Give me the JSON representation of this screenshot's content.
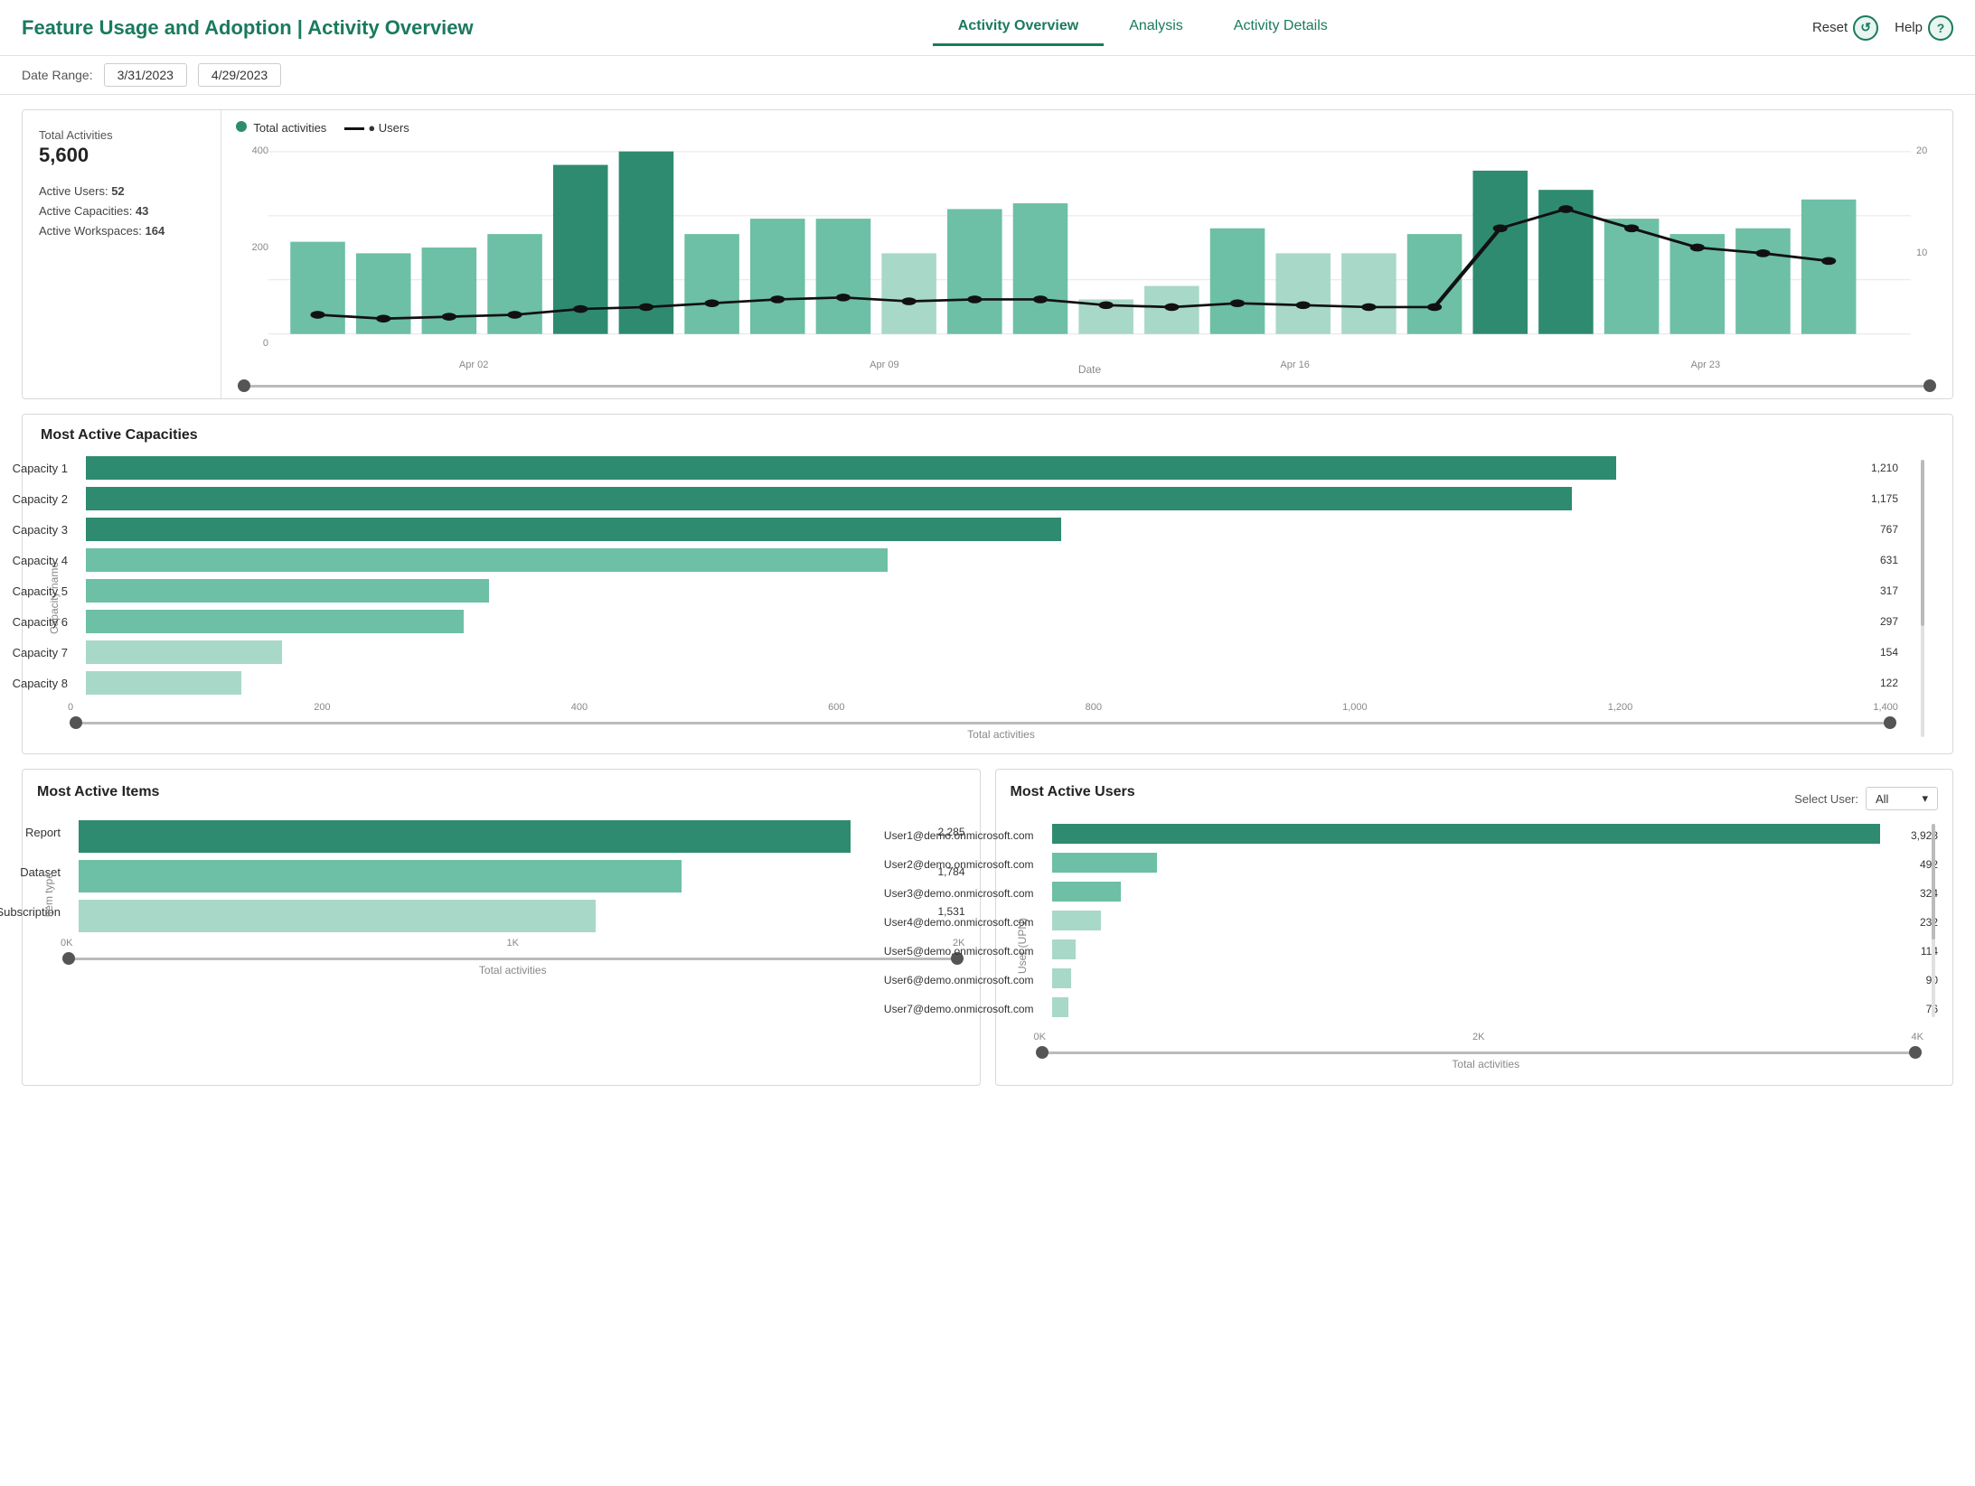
{
  "header": {
    "title": "Feature Usage and Adoption | Activity Overview",
    "nav": [
      {
        "label": "Activity Overview",
        "active": true
      },
      {
        "label": "Analysis",
        "active": false
      },
      {
        "label": "Activity Details",
        "active": false
      }
    ],
    "reset_label": "Reset",
    "help_label": "Help"
  },
  "date_range": {
    "label": "Date Range:",
    "start": "3/31/2023",
    "end": "4/29/2023"
  },
  "summary": {
    "total_activities_label": "Total Activities",
    "total_activities_value": "5,600",
    "active_users_label": "Active Users:",
    "active_users_value": "52",
    "active_capacities_label": "Active Capacities:",
    "active_capacities_value": "43",
    "active_workspaces_label": "Active Workspaces:",
    "active_workspaces_value": "164"
  },
  "activity_chart": {
    "legend_activities": "Total activities",
    "legend_users": "Users",
    "y_left_label": "Total activities",
    "y_right_label": "Users",
    "x_label": "Date",
    "x_ticks": [
      "Apr 02",
      "Apr 09",
      "Apr 16",
      "Apr 23"
    ],
    "y_left_ticks": [
      "0",
      "200",
      "400"
    ],
    "y_right_ticks": [
      "10",
      "20"
    ],
    "bars": [
      {
        "x": 0.03,
        "h": 0.48,
        "shade": 0.7
      },
      {
        "x": 0.07,
        "h": 0.42,
        "shade": 0.7
      },
      {
        "x": 0.11,
        "h": 0.45,
        "shade": 0.7
      },
      {
        "x": 0.15,
        "h": 0.52,
        "shade": 0.7
      },
      {
        "x": 0.19,
        "h": 0.88,
        "shade": 1.0
      },
      {
        "x": 0.23,
        "h": 0.95,
        "shade": 1.0
      },
      {
        "x": 0.27,
        "h": 0.52,
        "shade": 0.7
      },
      {
        "x": 0.31,
        "h": 0.6,
        "shade": 0.7
      },
      {
        "x": 0.35,
        "h": 0.6,
        "shade": 0.7
      },
      {
        "x": 0.39,
        "h": 0.42,
        "shade": 0.5
      },
      {
        "x": 0.43,
        "h": 0.65,
        "shade": 0.7
      },
      {
        "x": 0.47,
        "h": 0.68,
        "shade": 0.7
      },
      {
        "x": 0.51,
        "h": 0.18,
        "shade": 0.3
      },
      {
        "x": 0.55,
        "h": 0.25,
        "shade": 0.3
      },
      {
        "x": 0.59,
        "h": 0.55,
        "shade": 0.7
      },
      {
        "x": 0.63,
        "h": 0.42,
        "shade": 0.5
      },
      {
        "x": 0.67,
        "h": 0.42,
        "shade": 0.5
      },
      {
        "x": 0.71,
        "h": 0.52,
        "shade": 0.7
      },
      {
        "x": 0.75,
        "h": 0.85,
        "shade": 1.0
      },
      {
        "x": 0.79,
        "h": 0.75,
        "shade": 1.0
      },
      {
        "x": 0.83,
        "h": 0.6,
        "shade": 0.7
      },
      {
        "x": 0.87,
        "h": 0.52,
        "shade": 0.7
      },
      {
        "x": 0.91,
        "h": 0.55,
        "shade": 0.7
      },
      {
        "x": 0.95,
        "h": 0.7,
        "shade": 0.7
      }
    ],
    "line_points": [
      0.1,
      0.08,
      0.09,
      0.1,
      0.13,
      0.14,
      0.16,
      0.18,
      0.19,
      0.17,
      0.18,
      0.18,
      0.15,
      0.14,
      0.16,
      0.15,
      0.14,
      0.14,
      0.55,
      0.65,
      0.55,
      0.45,
      0.42,
      0.38
    ]
  },
  "capacities": {
    "title": "Most Active Capacities",
    "y_label": "Capacity name",
    "x_label": "Total activities",
    "x_ticks": [
      "0",
      "200",
      "400",
      "600",
      "800",
      "1,000",
      "1,200",
      "1,400"
    ],
    "max": 1400,
    "items": [
      {
        "label": "Capacity 1",
        "value": 1210,
        "shade": "dark"
      },
      {
        "label": "Capacity 2",
        "value": 1175,
        "shade": "dark"
      },
      {
        "label": "Capacity 3",
        "value": 767,
        "shade": "dark"
      },
      {
        "label": "Capacity 4",
        "value": 631,
        "shade": "mid"
      },
      {
        "label": "Capacity 5",
        "value": 317,
        "shade": "mid"
      },
      {
        "label": "Capacity 6",
        "value": 297,
        "shade": "mid"
      },
      {
        "label": "Capacity 7",
        "value": 154,
        "shade": "light"
      },
      {
        "label": "Capacity 8",
        "value": 122,
        "shade": "light"
      }
    ]
  },
  "most_active_items": {
    "title": "Most Active Items",
    "y_label": "Item type",
    "x_label": "Total activities",
    "x_ticks": [
      "0K",
      "1K",
      "2K"
    ],
    "max": 2500,
    "items": [
      {
        "label": "Report",
        "value": 2285,
        "shade": "dark"
      },
      {
        "label": "Dataset",
        "value": 1784,
        "shade": "mid"
      },
      {
        "label": "Email Subscription",
        "value": 1531,
        "shade": "light"
      }
    ]
  },
  "most_active_users": {
    "title": "Most Active Users",
    "select_user_label": "Select User:",
    "select_user_value": "All",
    "y_label": "User (UPN)",
    "x_label": "Total activities",
    "x_ticks": [
      "0K",
      "2K",
      "4K"
    ],
    "max": 4000,
    "items": [
      {
        "label": "User1@demo.onmicrosoft.com",
        "value": 3923,
        "shade": "dark"
      },
      {
        "label": "User2@demo.onmicrosoft.com",
        "value": 492,
        "shade": "mid"
      },
      {
        "label": "User3@demo.onmicrosoft.com",
        "value": 324,
        "shade": "mid"
      },
      {
        "label": "User4@demo.onmicrosoft.com",
        "value": 232,
        "shade": "light"
      },
      {
        "label": "User5@demo.onmicrosoft.com",
        "value": 114,
        "shade": "light"
      },
      {
        "label": "User6@demo.onmicrosoft.com",
        "value": 90,
        "shade": "light"
      },
      {
        "label": "User7@demo.onmicrosoft.com",
        "value": 76,
        "shade": "light"
      }
    ]
  },
  "colors": {
    "accent_dark": "#2e8b70",
    "accent_mid": "#6dbfa5",
    "accent_light": "#a8d8c8",
    "brand": "#1a7a5e"
  }
}
